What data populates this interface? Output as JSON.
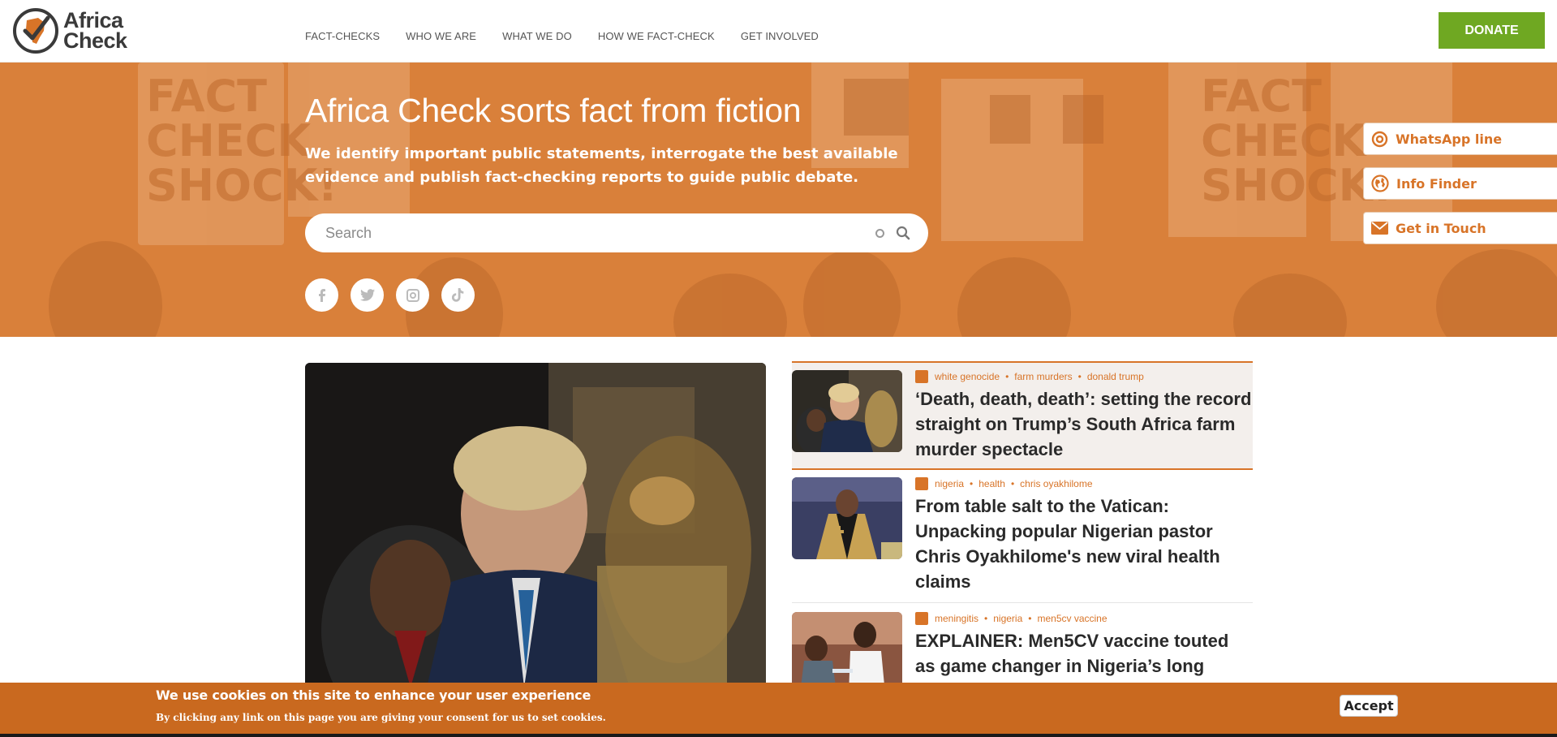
{
  "header": {
    "logo_text_line1": "Africa",
    "logo_text_line2": "Check",
    "nav": [
      "FACT-CHECKS",
      "WHO WE ARE",
      "WHAT WE DO",
      "HOW WE FACT-CHECK",
      "GET INVOLVED"
    ],
    "donate_label": "DONATE"
  },
  "hero": {
    "title": "Africa Check sorts fact from fiction",
    "subtitle": "We identify important public statements, interrogate the best available evidence and publish fact-checking reports to guide public debate.",
    "search_placeholder": "Search",
    "social_icons": [
      "facebook-icon",
      "twitter-icon",
      "instagram-icon",
      "tiktok-icon"
    ],
    "side_links": [
      {
        "label": "WhatsApp line",
        "icon": "whatsapp-icon"
      },
      {
        "label": "Info Finder",
        "icon": "globe-icon"
      },
      {
        "label": "Get in Touch",
        "icon": "envelope-icon"
      }
    ]
  },
  "stories": [
    {
      "tags": [
        "white genocide",
        "farm murders",
        "donald trump"
      ],
      "headline": "‘Death, death, death’: setting the record straight on Trump’s South Africa farm murder spectacle"
    },
    {
      "tags": [
        "nigeria",
        "health",
        "chris oyakhilome"
      ],
      "headline": "From table salt to the Vatican: Unpacking popular Nigerian pastor Chris Oyakhilome's new viral health claims"
    },
    {
      "tags": [
        "meningitis",
        "nigeria",
        "men5cv vaccine"
      ],
      "headline": "EXPLAINER: Men5CV vaccine touted as game changer in Nigeria’s long battle"
    }
  ],
  "cookie": {
    "title": "We use cookies on this site to enhance your user experience",
    "text": "By clicking any link on this page you are giving your consent for us to set cookies.",
    "accept_label": "Accept"
  },
  "colors": {
    "brand_orange": "#d87428",
    "donate_green": "#6fa822",
    "cookie_bg": "#c9691f"
  }
}
